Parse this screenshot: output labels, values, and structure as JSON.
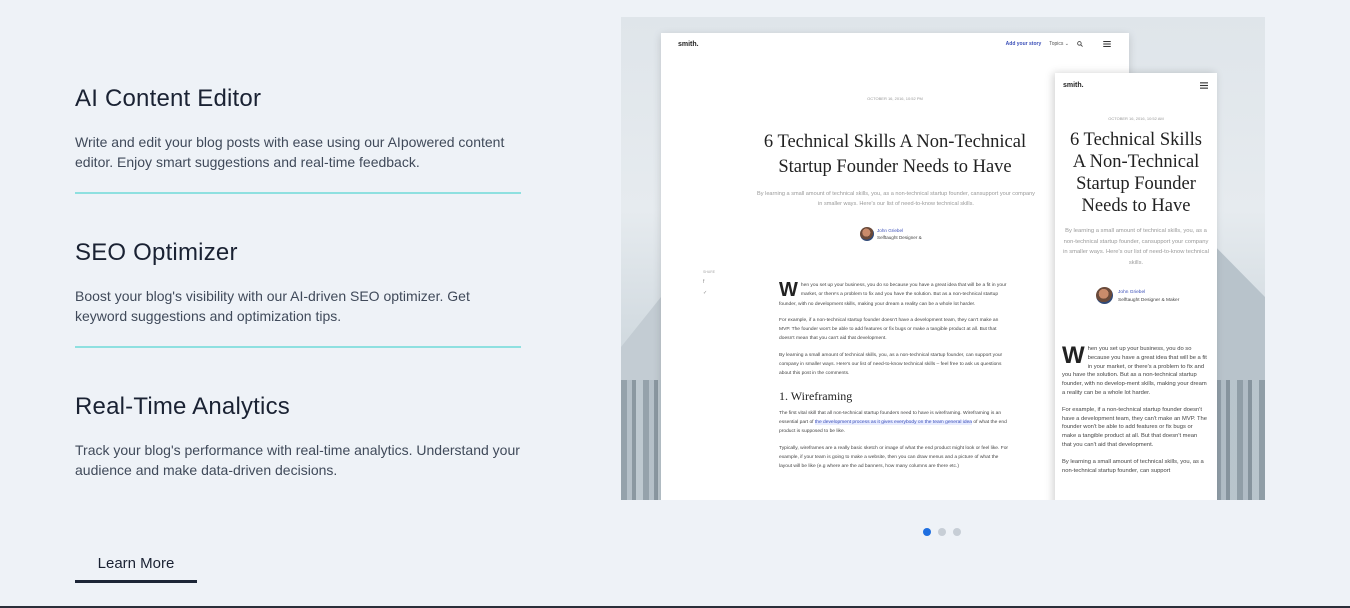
{
  "features": [
    {
      "title": "AI Content Editor",
      "description": "Write and edit your blog posts with ease using our AIpowered content editor. Enjoy smart suggestions and real-time feedback."
    },
    {
      "title": "SEO Optimizer",
      "description": "Boost your blog's visibility with our AI-driven SEO optimizer. Get keyword suggestions and optimization tips."
    },
    {
      "title": "Real-Time Analytics",
      "description": "Track your blog's performance with real-time analytics. Understand your audience and make data-driven decisions."
    }
  ],
  "cta": {
    "label": "Learn More"
  },
  "showcase": {
    "desktop": {
      "logo": "smith.",
      "nav": {
        "story": "Add your story",
        "topics": "Topics ⌄"
      },
      "date": "OCTOBER 16, 2016, 10:52 PM",
      "title": "6 Technical Skills A Non-Technical Startup Founder Needs to Have",
      "subtitle": "By learning a small amount of technical skills, you, as a non-technical startup founder, cansupport your company in smaller ways. Here's our list of need-to-know technical skills.",
      "author_name": "John Griebel",
      "author_role": "Selftaught Designer &",
      "share": "SHARE",
      "p1": "hen you set up your business, you do so because you have a great idea that will be a fit in your market, or there's a problem to fix and you have the solution. But as a non-technical startup founder, with no development skills, making your dream a reality can be a whole lot harder.",
      "p2": "For example, if a non-technical startup founder doesn't have a development team, they can't make an MVP. The founder won't be able to add features or fix bugs or make a tangible product at all. But that doesn't mean that you can't aid that development.",
      "p3": "By learning a small amount of technical skills, you, as a non-technical startup founder, can support your company in smaller ways. Here's our list of need-to-know technical skills – feel free to ask us questions about this post in the comments.",
      "heading": "1. Wireframing",
      "p4a": "The first vital skill that all non-technical startup founders need to have is wireframing. Wireframing is an essential part of ",
      "p4link": "the development process as it gives everybody on the team general idea",
      "p4b": " of what the end product is supposed to be like.",
      "p5": "Typically, wireframes are a really basic sketch or image of what the end product might look or feel like. For example, if your team is going to make a website, then you can draw menus and a picture of what the layout will be like (e.g where are the ad banners, how many columns are there etc.)"
    },
    "mobile": {
      "logo": "smith.",
      "date": "OCTOBER 16, 2016, 10:52 AM",
      "title": "6 Technical Skills A Non-Technical Startup Founder Needs to Have",
      "subtitle": "By learning a small amount of technical skills, you, as a non-technical startup founder, cansupport your company in smaller ways. Here's our list of need-to-know technical skills.",
      "author_name": "John Griebel",
      "author_role": "Selftaught Designer & Maker",
      "p1": "hen you set up your business, you do so because you have a great idea that will be a fit in your market, or there's a problem to fix and you have the solution. But as a non-technical startup founder, with no develop-ment skills, making your dream a reality can be a whole lot harder.",
      "p2": "For example, if a non-technical startup founder doesn't have a development team, they can't make an MVP. The founder won't be able to add features or fix bugs or make a tangible product at all. But that doesn't mean that you can't aid that development.",
      "p3": "By learning a small amount of technical skills, you, as a non-technical startup founder, can support"
    },
    "dropcap": "W"
  },
  "carousel": {
    "count": 3,
    "active_index": 0,
    "active_color": "#1f6fe0",
    "inactive_color": "#c7ced6"
  },
  "colors": {
    "accent_rule": "#8ee0e0",
    "text": "#1c2536",
    "background": "#eef2f7"
  }
}
